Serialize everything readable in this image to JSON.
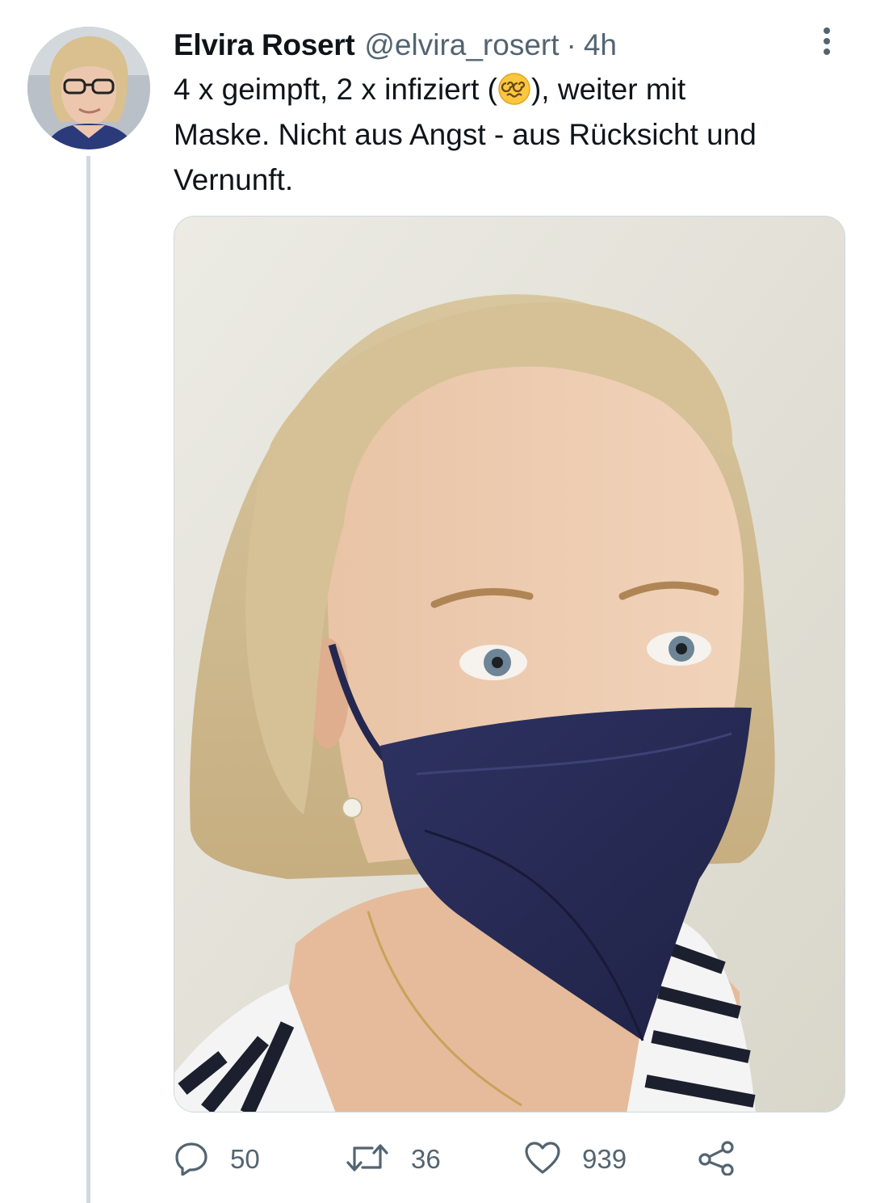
{
  "tweet": {
    "author": {
      "display_name": "Elvira Rosert",
      "handle": "@elvira_rosert",
      "separator": "·",
      "time": "4h"
    },
    "text_lines": [
      {
        "before_emoji": "4 x geimpft, 2 x infiziert (",
        "emoji": "dizzy-face",
        "after_emoji": "), weiter mit"
      },
      "Maske. Nicht aus Angst - aus Rücksicht und",
      "Vernunft."
    ],
    "actions": {
      "reply": {
        "icon": "reply-icon",
        "count": "50"
      },
      "retweet": {
        "icon": "retweet-icon",
        "count": "36"
      },
      "like": {
        "icon": "heart-icon",
        "count": "939"
      },
      "share": {
        "icon": "share-icon"
      }
    }
  },
  "colors": {
    "text_primary": "#0f1419",
    "text_secondary": "#536471",
    "thread_line": "#cfd9de",
    "mask_navy": "#2a2d55"
  }
}
